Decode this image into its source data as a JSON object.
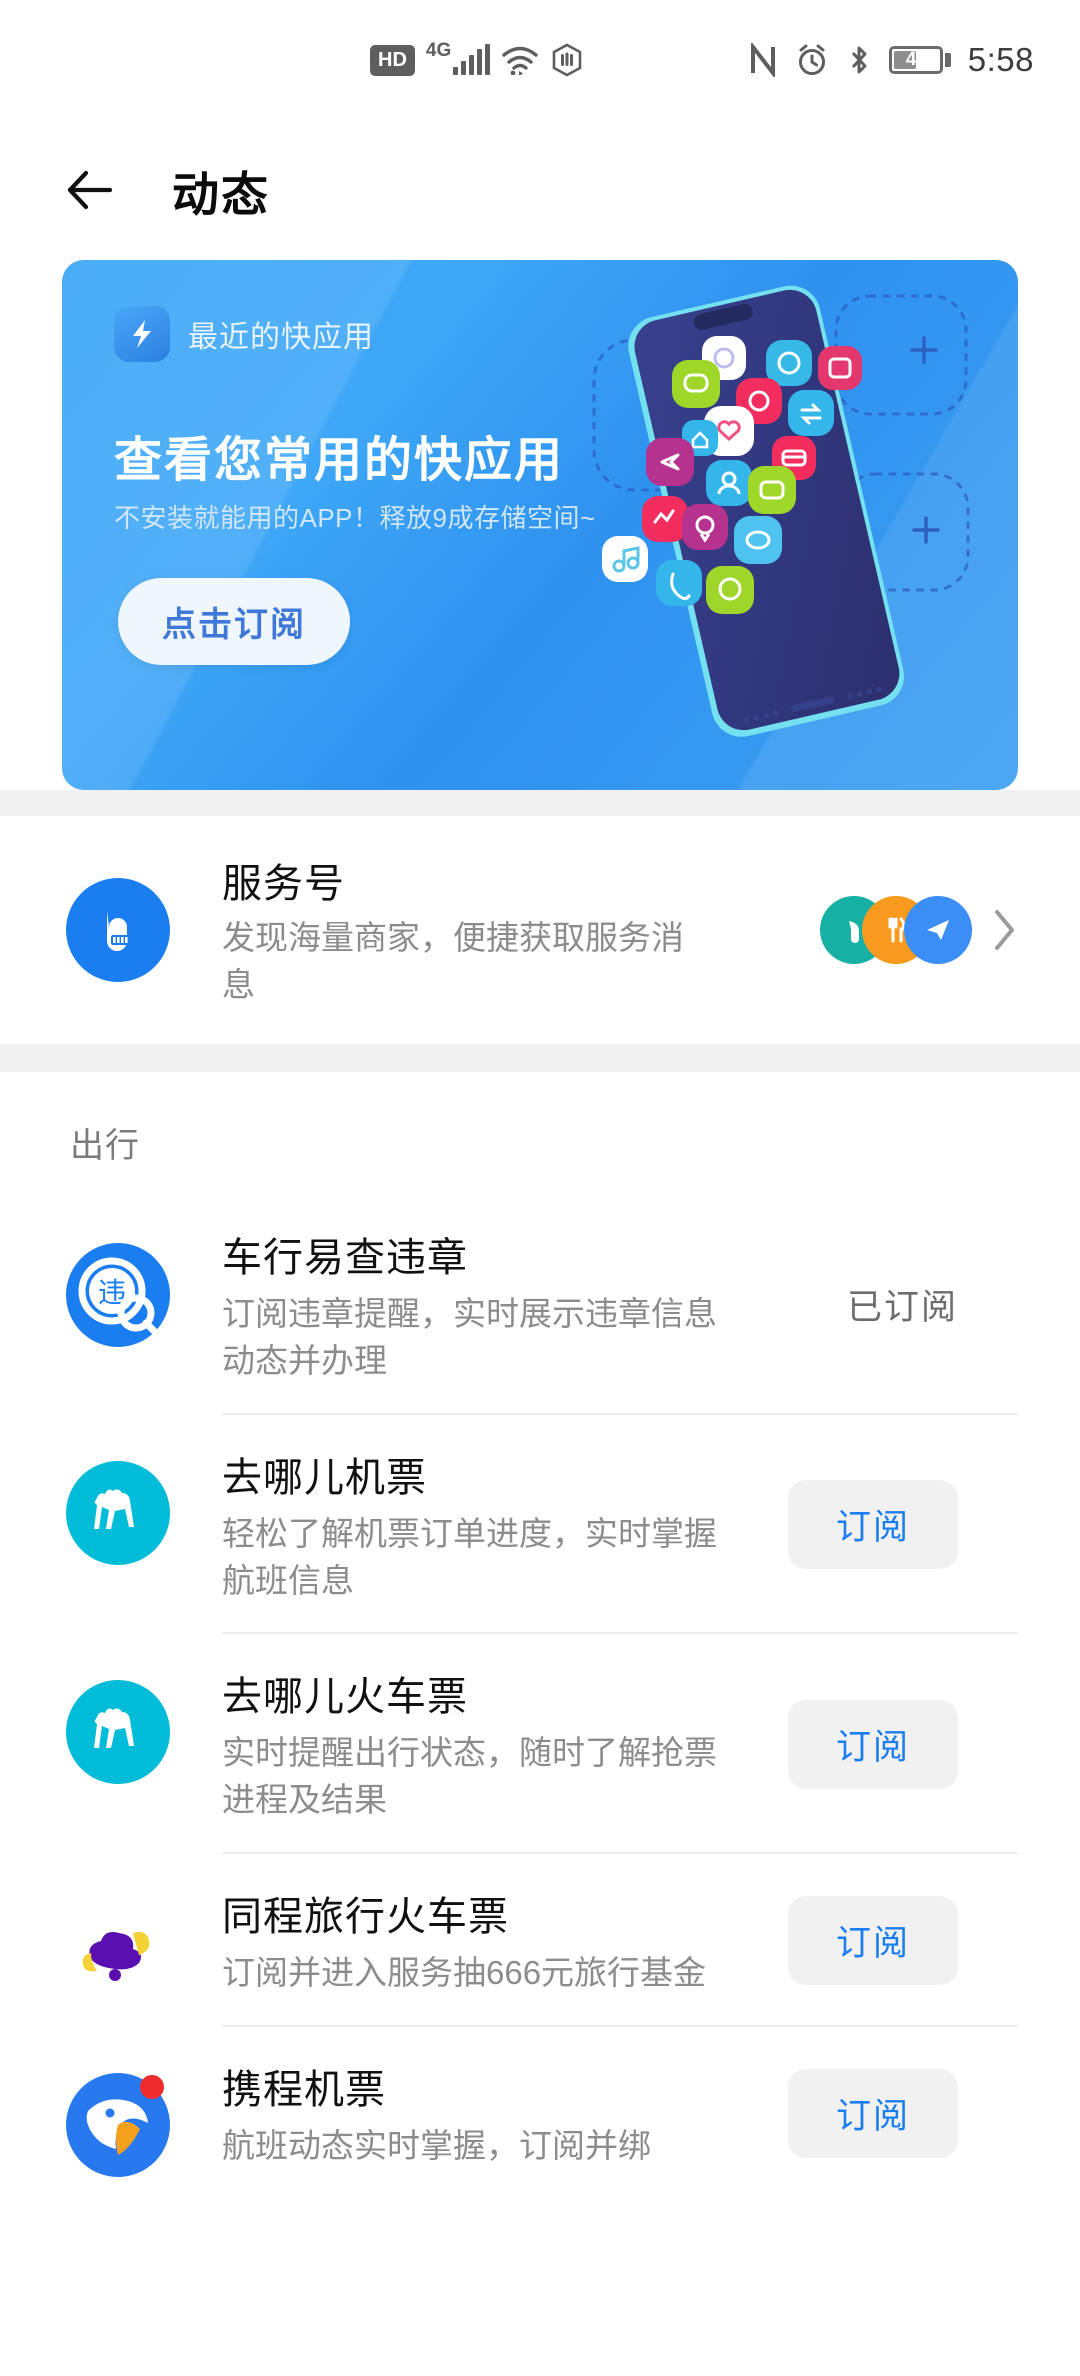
{
  "statusbar": {
    "hd_label": "HD",
    "network_label": "4G",
    "time": "5:58",
    "battery_percent": "46",
    "icons": [
      "hd-icon",
      "signal-4g-icon",
      "wifi-icon",
      "do-not-disturb-icon",
      "nfc-icon",
      "alarm-icon",
      "bluetooth-icon",
      "battery-icon"
    ]
  },
  "header": {
    "title": "动态",
    "back_label": "返回"
  },
  "banner": {
    "brand": "最近的快应用",
    "title": "查看您常用的快应用",
    "subtitle": "不安装就能用的APP！释放9成存储空间~",
    "cta": "点击订阅",
    "bg_color": "#37a4f5",
    "cta_text_color": "#3f78d8"
  },
  "service": {
    "title": "服务号",
    "desc": "发现海量商家，便捷获取服务消息",
    "icon_color": "#1a7ef0",
    "avatar_colors": [
      "#17b0a5",
      "#f79a1e",
      "#3b8ef5"
    ]
  },
  "section": {
    "title": "出行"
  },
  "apps": [
    {
      "name": "车行易查违章",
      "desc": "订阅违章提醒，实时展示违章信息动态并办理",
      "action": "已订阅",
      "action_type": "subscribed",
      "icon": "violation-check-icon",
      "icon_color": "#1a7ef0",
      "has_badge": false
    },
    {
      "name": "去哪儿机票",
      "desc": "轻松了解机票订单进度，实时掌握航班信息",
      "action": "订阅",
      "action_type": "subscribe",
      "icon": "camel-icon",
      "icon_color": "#00bcd8",
      "has_badge": false
    },
    {
      "name": "去哪儿火车票",
      "desc": "实时提醒出行状态，随时了解抢票进程及结果",
      "action": "订阅",
      "action_type": "subscribe",
      "icon": "camel-icon",
      "icon_color": "#00bcd8",
      "has_badge": false
    },
    {
      "name": "同程旅行火车票",
      "desc": "订阅并进入服务抽666元旅行基金",
      "action": "订阅",
      "action_type": "subscribe",
      "icon": "tongcheng-icon",
      "icon_color": "#ffffff",
      "has_badge": false
    },
    {
      "name": "携程机票",
      "desc": "航班动态实时掌握，订阅并绑",
      "action": "订阅",
      "action_type": "subscribe",
      "icon": "ctrip-dolphin-icon",
      "icon_color": "#2878f0",
      "has_badge": true
    }
  ]
}
